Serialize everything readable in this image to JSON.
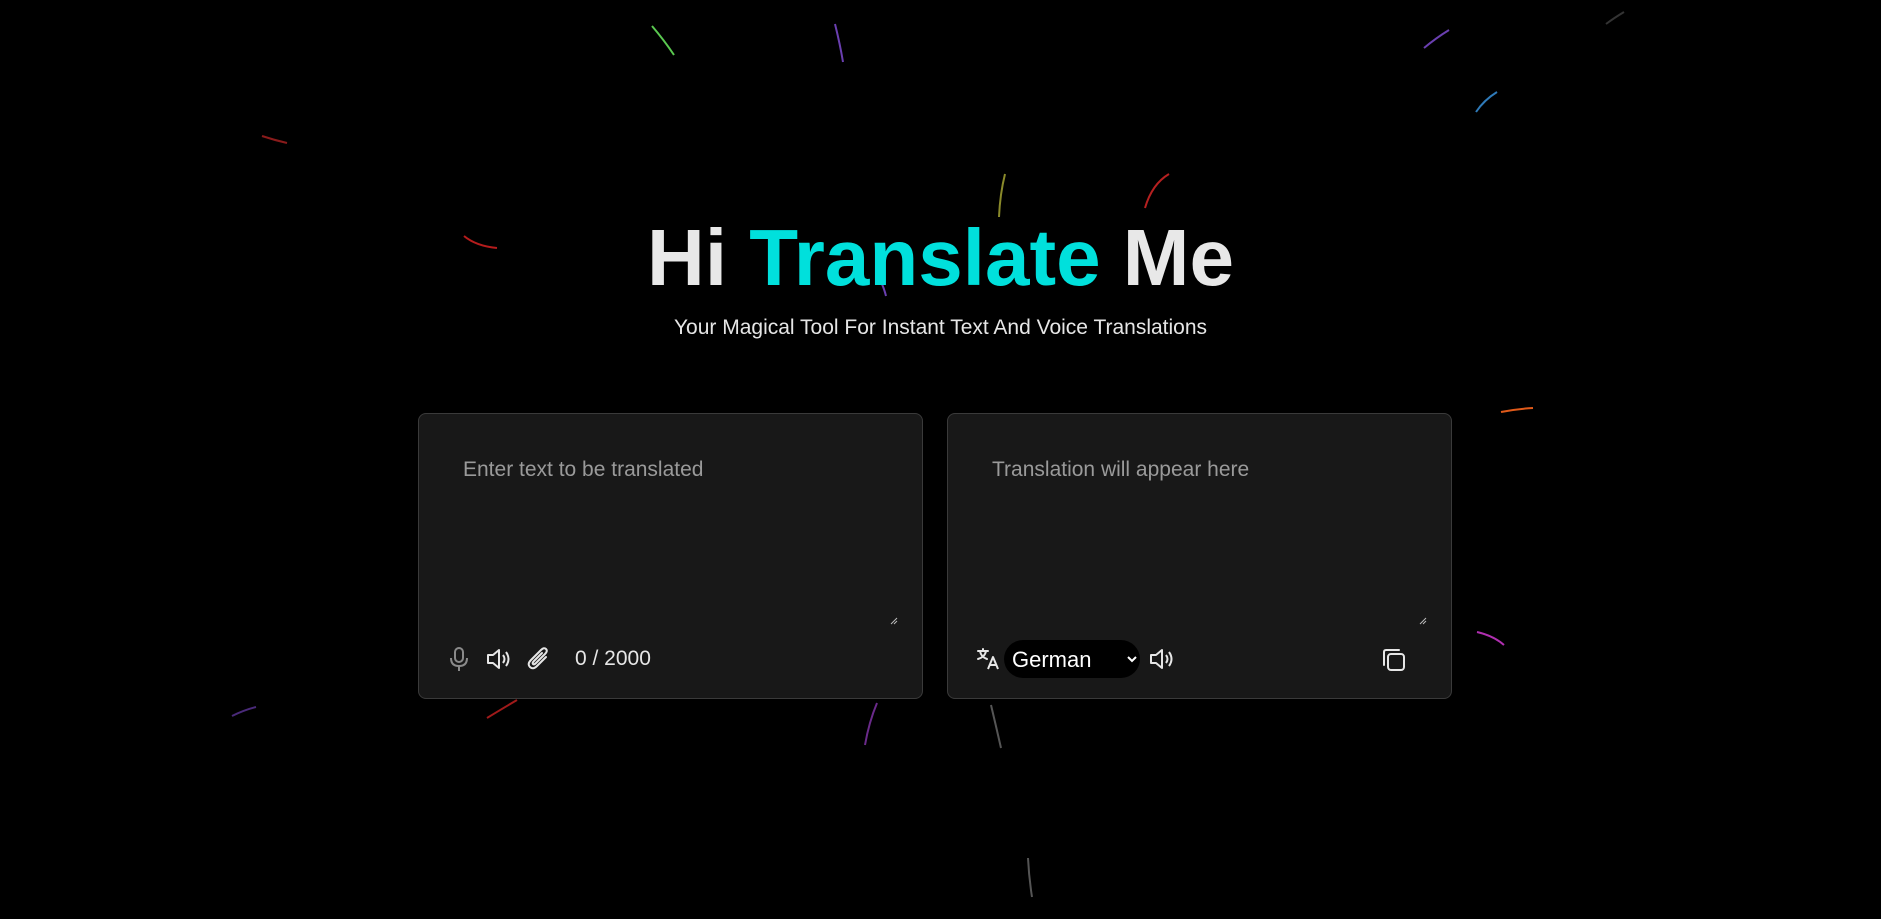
{
  "hero": {
    "title_prefix": "Hi ",
    "title_accent": "Translate",
    "title_suffix": " Me",
    "subtitle": "Your Magical Tool For Instant Text And Voice Translations"
  },
  "source_panel": {
    "placeholder": "Enter text to be translated",
    "counter": "0 / 2000",
    "icons": [
      "microphone-icon",
      "speaker-icon",
      "paperclip-icon"
    ]
  },
  "target_panel": {
    "placeholder": "Translation will appear here",
    "language_selected": "German",
    "icons": [
      "translate-icon",
      "speaker-icon",
      "copy-icon"
    ]
  },
  "colors": {
    "background": "#000000",
    "accent": "#00e0dc",
    "panel": "#181818",
    "panel_border": "#3a3a3a"
  }
}
